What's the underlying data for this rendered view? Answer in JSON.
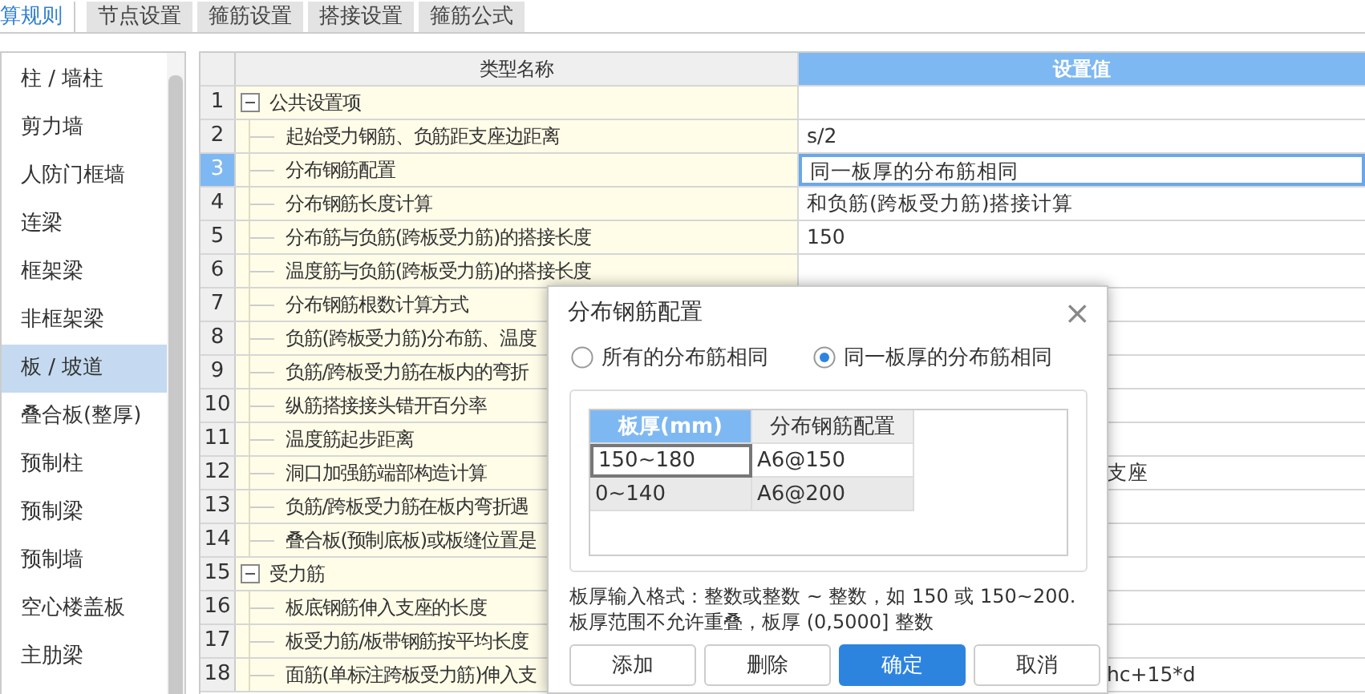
{
  "tabs": [
    {
      "label": "算规则",
      "selected": true
    },
    {
      "label": "节点设置",
      "selected": false
    },
    {
      "label": "箍筋设置",
      "selected": false
    },
    {
      "label": "搭接设置",
      "selected": false
    },
    {
      "label": "箍筋公式",
      "selected": false
    }
  ],
  "sidebar": {
    "items": [
      {
        "label": "柱 / 墙柱",
        "selected": false
      },
      {
        "label": "剪力墙",
        "selected": false
      },
      {
        "label": "人防门框墙",
        "selected": false
      },
      {
        "label": "连梁",
        "selected": false
      },
      {
        "label": "框架梁",
        "selected": false
      },
      {
        "label": "非框架梁",
        "selected": false
      },
      {
        "label": "板 / 坡道",
        "selected": true
      },
      {
        "label": "叠合板(整厚)",
        "selected": false
      },
      {
        "label": "预制柱",
        "selected": false
      },
      {
        "label": "预制梁",
        "selected": false
      },
      {
        "label": "预制墙",
        "selected": false
      },
      {
        "label": "空心楼盖板",
        "selected": false
      },
      {
        "label": "主肋梁",
        "selected": false
      }
    ]
  },
  "table": {
    "columns": [
      "类型名称",
      "设置值"
    ],
    "rows": [
      {
        "number": "1",
        "kind": "group",
        "expanded": true,
        "name": "公共设置项",
        "selected": false
      },
      {
        "number": "2",
        "kind": "item",
        "name": "起始受力钢筋、负筋距支座边距离",
        "value": "s/2",
        "selected": false
      },
      {
        "number": "3",
        "kind": "item",
        "name": "分布钢筋配置",
        "value": "同一板厚的分布筋相同",
        "selected": true
      },
      {
        "number": "4",
        "kind": "item",
        "name": "分布钢筋长度计算",
        "value": "和负筋(跨板受力筋)搭接计算",
        "selected": false
      },
      {
        "number": "5",
        "kind": "item",
        "name": "分布筋与负筋(跨板受力筋)的搭接长度",
        "value": "150",
        "selected": false
      },
      {
        "number": "6",
        "kind": "item",
        "name": "温度筋与负筋(跨板受力筋)的搭接长度",
        "selected": false
      },
      {
        "number": "7",
        "kind": "item",
        "name": "分布钢筋根数计算方式",
        "selected": false
      },
      {
        "number": "8",
        "kind": "item",
        "name": "负筋(跨板受力筋)分布筋、温度",
        "selected": false
      },
      {
        "number": "9",
        "kind": "item",
        "name": "负筋/跨板受力筋在板内的弯折",
        "selected": false
      },
      {
        "number": "10",
        "kind": "item",
        "name": "纵筋搭接接头错开百分率",
        "selected": false
      },
      {
        "number": "11",
        "kind": "item",
        "name": "温度筋起步距离",
        "selected": false
      },
      {
        "number": "12",
        "kind": "item",
        "name": "洞口加强筋端部构造计算",
        "value": "支座",
        "selected": false
      },
      {
        "number": "13",
        "kind": "item",
        "name": "负筋/跨板受力筋在板内弯折遇",
        "selected": false
      },
      {
        "number": "14",
        "kind": "item",
        "name": "叠合板(预制底板)或板缝位置是",
        "selected": false
      },
      {
        "number": "15",
        "kind": "group",
        "expanded": true,
        "name": "受力筋",
        "selected": false
      },
      {
        "number": "16",
        "kind": "item",
        "name": "板底钢筋伸入支座的长度",
        "selected": false
      },
      {
        "number": "17",
        "kind": "item",
        "name": "板受力筋/板带钢筋按平均长度",
        "selected": false
      },
      {
        "number": "18",
        "kind": "item",
        "name": "面筋(单标注跨板受力筋)伸入支",
        "value": "hc+15*d",
        "selected": false
      }
    ]
  },
  "dialog": {
    "title": "分布钢筋配置",
    "close": "×",
    "options": [
      {
        "label": "所有的分布筋相同",
        "selected": false
      },
      {
        "label": "同一板厚的分布筋相同",
        "selected": true
      }
    ],
    "grid": {
      "columns": [
        "板厚(mm)",
        "分布钢筋配置"
      ],
      "rows": [
        [
          "150~180",
          "A6@150"
        ],
        [
          "0~140",
          "A6@200"
        ]
      ]
    },
    "notes": [
      "板厚输入格式：整数或整数 ~ 整数，如 150 或 150~200.",
      "板厚范围不允许重叠，板厚 (0,5000] 整数"
    ],
    "buttons": [
      {
        "label": "添加",
        "kind": "default"
      },
      {
        "label": "删除",
        "kind": "default"
      },
      {
        "label": "确定",
        "kind": "primary"
      },
      {
        "label": "取消",
        "kind": "default"
      }
    ]
  }
}
